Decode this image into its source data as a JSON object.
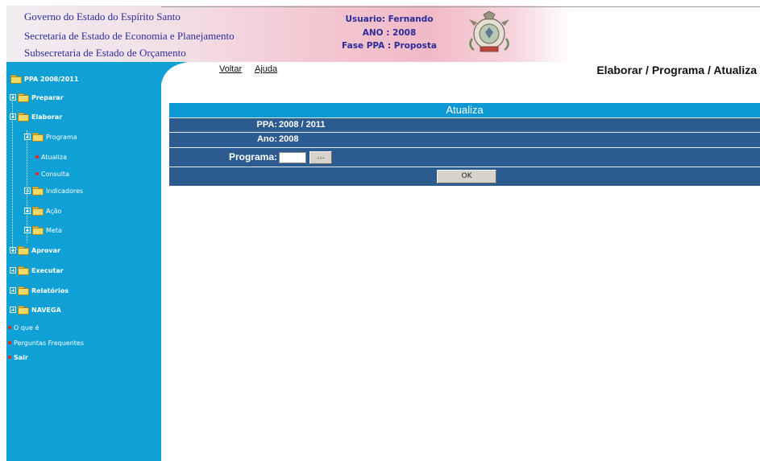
{
  "header": {
    "org_lines": [
      "Governo do Estado do Espírito Santo",
      "Secretaria de Estado de Economia e Planejamento",
      "Subsecretaria de Estado de Orçamento"
    ],
    "usuario": "Usuario: Fernando",
    "ano": "ANO : 2008",
    "fase": "Fase PPA : Proposta",
    "crest_icon": "state-crest-icon"
  },
  "toplinks": {
    "voltar": "Voltar",
    "ajuda": "Ajuda"
  },
  "breadcrumb": "Elaborar / Programa / Atualiza",
  "sidebar": {
    "root": "PPA 2008/2011",
    "items": {
      "preparar": "Preparar",
      "elaborar": "Elaborar",
      "programa": "Programa",
      "atualiza": "Atualiza",
      "consulta": "Consulta",
      "indicadores": "Indicadores",
      "acao": "Ação",
      "meta": "Meta",
      "aprovar": "Aprovar",
      "executar": "Executar",
      "relatorios": "Relatórios",
      "navega": "NAVEGA",
      "oque": "O que é",
      "perguntas": "Perguntas Frequentes",
      "sair": "Sair"
    }
  },
  "form": {
    "title": "Atualiza",
    "ppa_label": "PPA:",
    "ppa_value": "2008 / 2011",
    "ano_label": "Ano:",
    "ano_value": "2008",
    "programa_label": "Programa:",
    "programa_value": "",
    "lookup_label": "...",
    "ok_label": "OK"
  },
  "colors": {
    "sidebar": "#0fa0d6",
    "form_bg": "#2c5b8f",
    "form_title": "#0c98d3",
    "header_text": "#2b2b9a"
  }
}
